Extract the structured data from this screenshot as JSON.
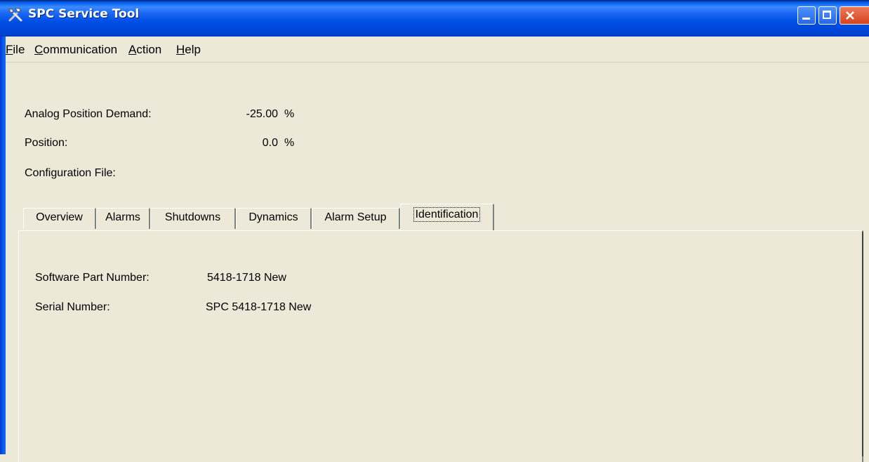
{
  "window": {
    "title": "SPC Service Tool"
  },
  "menu": {
    "items": [
      {
        "accel": "F",
        "rest": "ile"
      },
      {
        "accel": "C",
        "rest": "ommunication"
      },
      {
        "accel": "A",
        "rest": "ction"
      },
      {
        "accel": "H",
        "rest": "elp"
      }
    ]
  },
  "readouts": {
    "analog_label": "Analog Position Demand:",
    "analog_value": "-25.00",
    "analog_unit": "%",
    "position_label": "Position:",
    "position_value": "0.0",
    "position_unit": "%",
    "config_label": "Configuration File:",
    "config_value": ""
  },
  "tabs": [
    "Overview",
    "Alarms",
    "Shutdowns",
    "Dynamics",
    "Alarm Setup",
    "Identification"
  ],
  "active_tab": "Identification",
  "identification": {
    "software_label": "Software Part Number:",
    "software_value": "5418-1718 New",
    "serial_label": "Serial Number:",
    "serial_value": "SPC 5418-1718 New"
  },
  "icons": {
    "app": "tools-icon",
    "minimize": "minimize-icon",
    "maximize": "maximize-icon",
    "close": "close-icon"
  },
  "colors": {
    "titlebar": "#0050E6",
    "face": "#ECE9D8",
    "close": "#D6421E"
  }
}
